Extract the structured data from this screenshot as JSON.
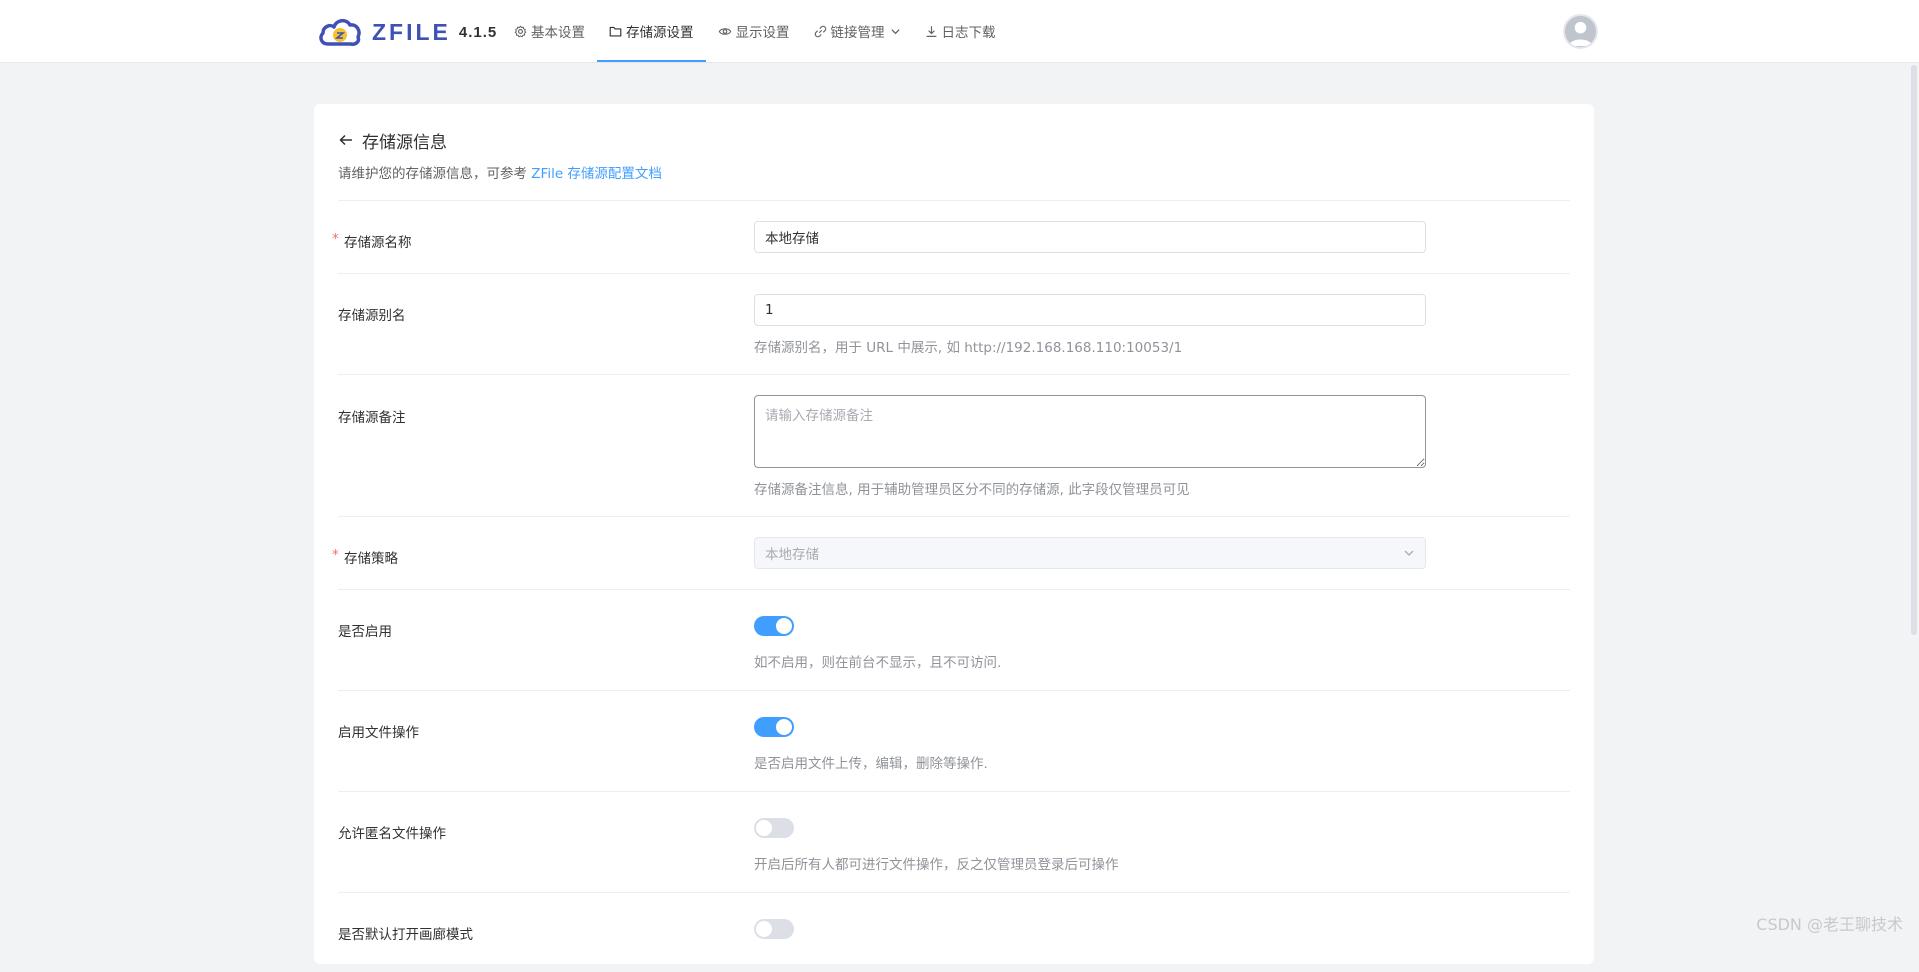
{
  "header": {
    "logo_text": "ZFILE",
    "version": "4.1.5",
    "nav": [
      {
        "label": "基本设置",
        "icon": "gear-icon",
        "active": false
      },
      {
        "label": "存储源设置",
        "icon": "folder-icon",
        "active": true
      },
      {
        "label": "显示设置",
        "icon": "eye-icon",
        "active": false
      },
      {
        "label": "链接管理",
        "icon": "link-icon",
        "active": false
      },
      {
        "label": "日志下载",
        "icon": "download-icon",
        "active": false
      }
    ]
  },
  "card": {
    "title": "存储源信息",
    "subtitle": "请维护您的存储源信息，可参考 ",
    "subtitle_link": "ZFile 存储源配置文档"
  },
  "form": {
    "name": {
      "label": "存储源名称",
      "required": true,
      "value": "本地存储"
    },
    "alias": {
      "label": "存储源别名",
      "value": "1",
      "help": "存储源别名，用于 URL 中展示, 如 http://192.168.168.110:10053/1"
    },
    "remark": {
      "label": "存储源备注",
      "placeholder": "请输入存储源备注",
      "help": "存储源备注信息, 用于辅助管理员区分不同的存储源, 此字段仅管理员可见"
    },
    "strategy": {
      "label": "存储策略",
      "required": true,
      "value": "本地存储"
    },
    "enable": {
      "label": "是否启用",
      "on": true,
      "help": "如不启用，则在前台不显示，且不可访问."
    },
    "file_ops": {
      "label": "启用文件操作",
      "on": true,
      "help": "是否启用文件上传，编辑，删除等操作."
    },
    "anon_ops": {
      "label": "允许匿名文件操作",
      "on": false,
      "help": "开启后所有人都可进行文件操作，反之仅管理员登录后可操作"
    },
    "gallery": {
      "label": "是否默认打开画廊模式",
      "on": false
    }
  },
  "watermark": "CSDN @老王聊技术",
  "colors": {
    "primary": "#409eff",
    "brand": "#3f51b5",
    "danger": "#f56c6c"
  }
}
